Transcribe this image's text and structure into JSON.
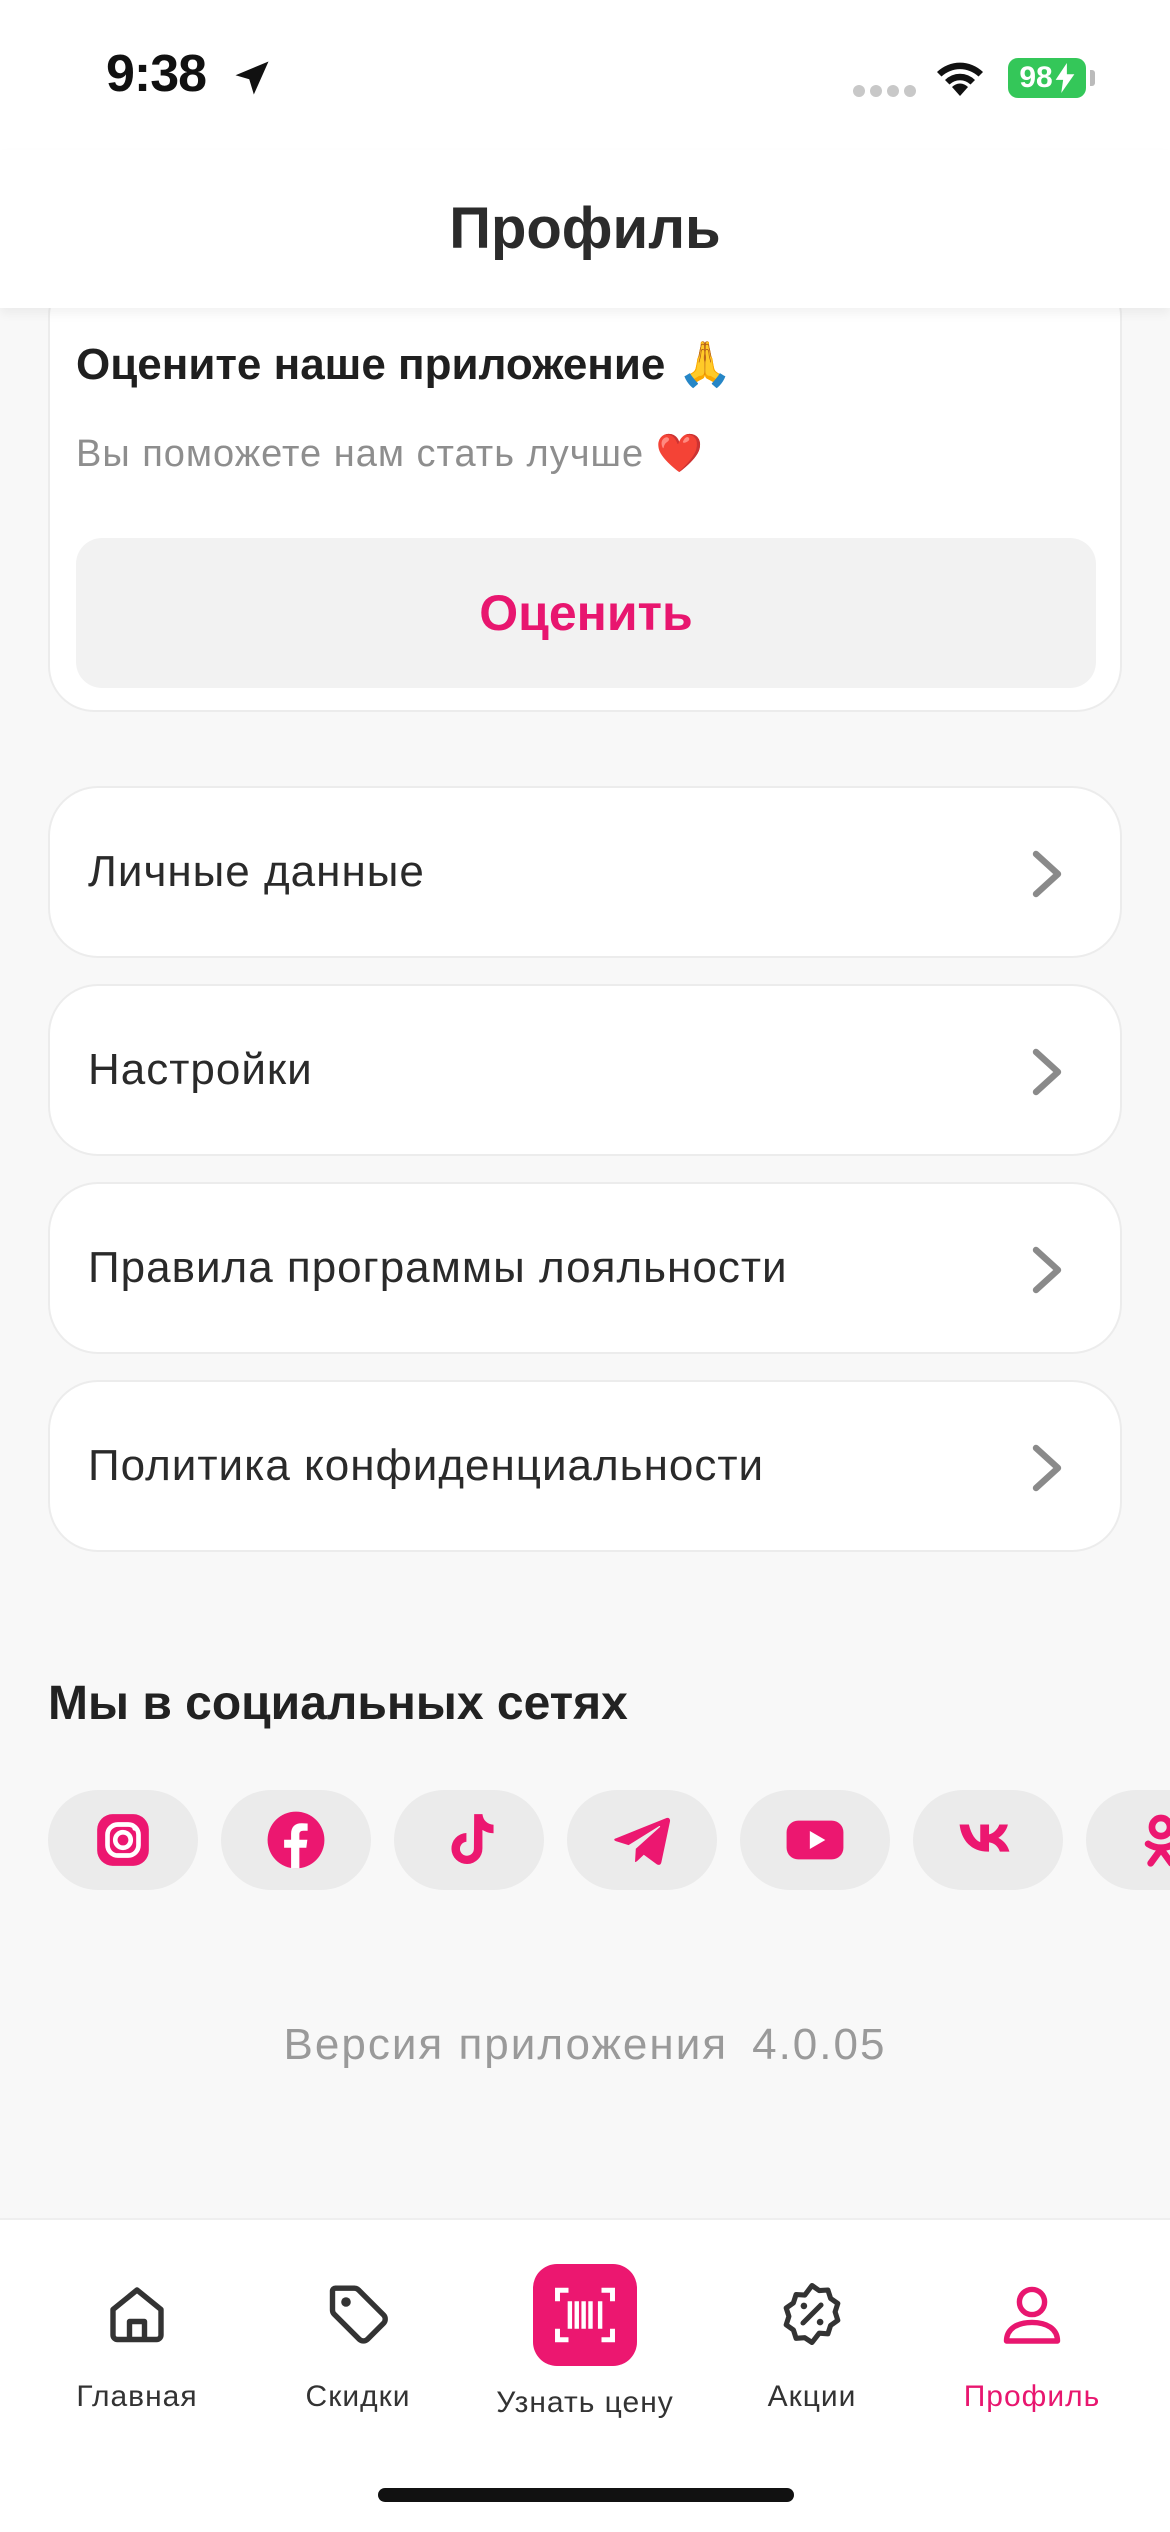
{
  "status_bar": {
    "time": "9:38",
    "battery": "98"
  },
  "header": {
    "title": "Профиль"
  },
  "rate_card": {
    "title": "Оцените наше приложение 🙏",
    "subtitle": "Вы поможете нам стать лучше ❤️",
    "button": "Оценить"
  },
  "menu": [
    {
      "label": "Личные данные"
    },
    {
      "label": "Настройки"
    },
    {
      "label": "Правила программы лояльности"
    },
    {
      "label": "Политика конфиденциальности"
    }
  ],
  "social": {
    "title": "Мы в социальных сетях",
    "networks": [
      "instagram-icon",
      "facebook-icon",
      "tiktok-icon",
      "telegram-icon",
      "youtube-icon",
      "vk-icon",
      "odnoklassniki-icon"
    ]
  },
  "version": {
    "label": "Версия приложения",
    "number": "4.0.05"
  },
  "tabbar": {
    "tabs": [
      {
        "label": "Главная",
        "icon": "home-icon"
      },
      {
        "label": "Скидки",
        "icon": "tag-icon"
      },
      {
        "label": "Узнать цену",
        "icon": "barcode-scan-icon"
      },
      {
        "label": "Акции",
        "icon": "percent-badge-icon"
      },
      {
        "label": "Профиль",
        "icon": "user-icon",
        "active": true
      }
    ]
  },
  "colors": {
    "accent": "#e8166f",
    "battery": "#34c759"
  }
}
